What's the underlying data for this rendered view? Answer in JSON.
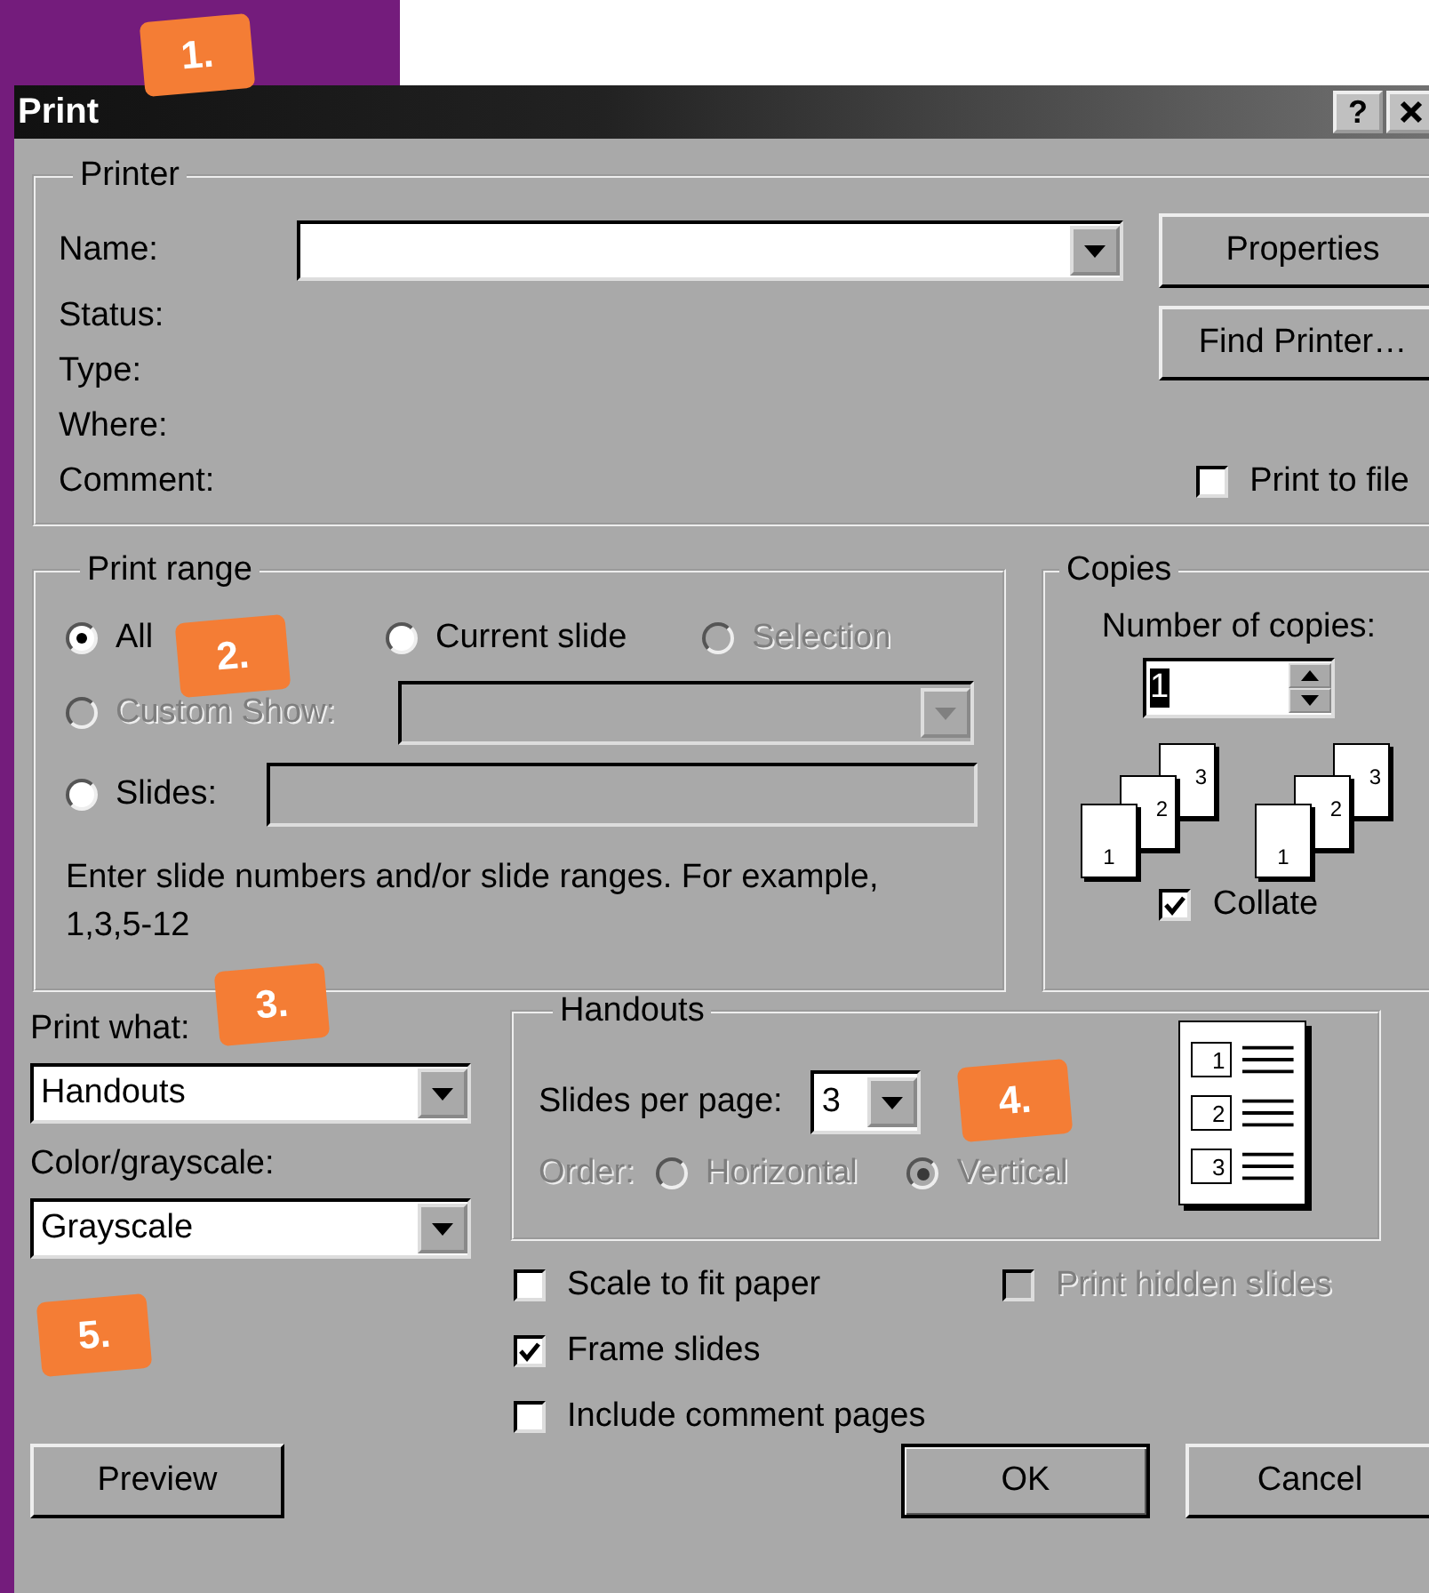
{
  "window": {
    "title": "Print",
    "help_button": "?"
  },
  "printer": {
    "legend": "Printer",
    "labels": [
      "Name:",
      "Status:",
      "Type:",
      "Where:",
      "Comment:"
    ],
    "buttons": [
      "Properties",
      "Find Printer…"
    ],
    "print_to_file": {
      "label": "Print to file",
      "checked": false
    }
  },
  "print_range": {
    "legend": "Print range",
    "options": [
      {
        "label": "All",
        "selected": true,
        "disabled": false
      },
      {
        "label": "Current slide",
        "selected": false,
        "disabled": false
      },
      {
        "label": "Selection",
        "selected": false,
        "disabled": true
      },
      {
        "label": "Custom Show:",
        "selected": false,
        "disabled": true
      },
      {
        "label": "Slides:",
        "selected": false,
        "disabled": false
      }
    ],
    "hint": "Enter slide numbers and/or slide ranges. For example, 1,3,5-12"
  },
  "copies": {
    "legend": "Copies",
    "label": "Number of copies:",
    "value": "1",
    "stacks": [
      [
        "1",
        "2",
        "3"
      ],
      [
        "1",
        "2",
        "3"
      ]
    ],
    "collate": {
      "label": "Collate",
      "checked": true
    }
  },
  "print_what": {
    "label": "Print what:",
    "value": "Handouts"
  },
  "color": {
    "label": "Color/grayscale:",
    "value": "Grayscale"
  },
  "handouts": {
    "legend": "Handouts",
    "slides_per_page_label": "Slides per page:",
    "slides_per_page": "3",
    "order_label": "Order:",
    "order_disabled": true,
    "order": [
      {
        "label": "Horizontal",
        "selected": false
      },
      {
        "label": "Vertical",
        "selected": true
      }
    ],
    "preview_numbers": [
      "1",
      "2",
      "3"
    ]
  },
  "options": [
    {
      "label": "Scale to fit paper",
      "checked": false,
      "disabled": false
    },
    {
      "label": "Print hidden slides",
      "checked": false,
      "disabled": true
    },
    {
      "label": "Frame slides",
      "checked": true,
      "disabled": false
    },
    {
      "label": "Include comment pages",
      "checked": false,
      "disabled": false
    }
  ],
  "buttons": [
    {
      "label": "Preview",
      "default": false
    },
    {
      "label": "OK",
      "default": true
    },
    {
      "label": "Cancel",
      "default": false
    }
  ],
  "annotations": [
    "1.",
    "2.",
    "3.",
    "4.",
    "5."
  ]
}
